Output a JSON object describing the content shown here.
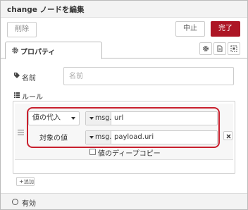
{
  "tray": {
    "title": "change ノードを編集"
  },
  "buttons": {
    "delete_label": "削除",
    "cancel_label": "中止",
    "done_label": "完了"
  },
  "tabs": {
    "properties_label": "プロパティ",
    "properties_icon": "gear-icon"
  },
  "toolbar_icons": [
    "gear-icon",
    "description-icon",
    "appearance-icon"
  ],
  "name_field": {
    "label": "名前",
    "icon": "tag-icon",
    "value": "",
    "placeholder": "名前"
  },
  "rules": {
    "label": "ルール",
    "icon": "list-icon",
    "items": [
      {
        "action": "値の代入",
        "target_type": "msg.",
        "target_value": "url",
        "to_label": "対象の値",
        "to_type": "msg.",
        "to_value": "payload.uri",
        "deep_copy_label": "値のディープコピー",
        "deep_copy_checked": false
      }
    ],
    "add_label": "追加"
  },
  "footer": {
    "enabled_label": "有効"
  },
  "colors": {
    "primary_button": "#ad1625",
    "highlight": "#c8202e",
    "border": "#cccccc",
    "header_bg": "#f3f3f3"
  }
}
